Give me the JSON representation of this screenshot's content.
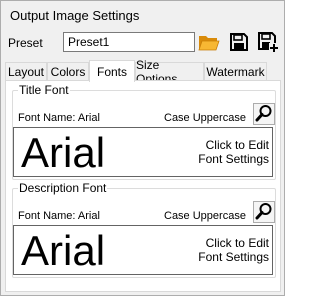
{
  "window": {
    "title": "Output Image Settings"
  },
  "preset": {
    "label": "Preset",
    "value": "Preset1",
    "buttons": [
      {
        "icon": "folder-open-icon"
      },
      {
        "icon": "save-icon"
      },
      {
        "icon": "save-add-icon"
      }
    ]
  },
  "tabs": [
    {
      "label": "Layout"
    },
    {
      "label": "Colors"
    },
    {
      "label": "Fonts",
      "active": true
    },
    {
      "label": "Size Options"
    },
    {
      "label": "Watermark"
    }
  ],
  "groups": {
    "title_font": {
      "title": "Title Font",
      "font_name": "Font Name: Arial",
      "case": "Case Uppercase",
      "sample": "Arial",
      "hint_line1": "Click to Edit",
      "hint_line2": "Font Settings"
    },
    "description_font": {
      "title": "Description Font",
      "font_name": "Font Name: Arial",
      "case": "Case Uppercase",
      "sample": "Arial",
      "hint_line1": "Click to Edit",
      "hint_line2": "Font Settings"
    }
  },
  "colors": {
    "folder": "#f5a623",
    "save": "#000000",
    "panel_border": "#d9d9d9"
  }
}
